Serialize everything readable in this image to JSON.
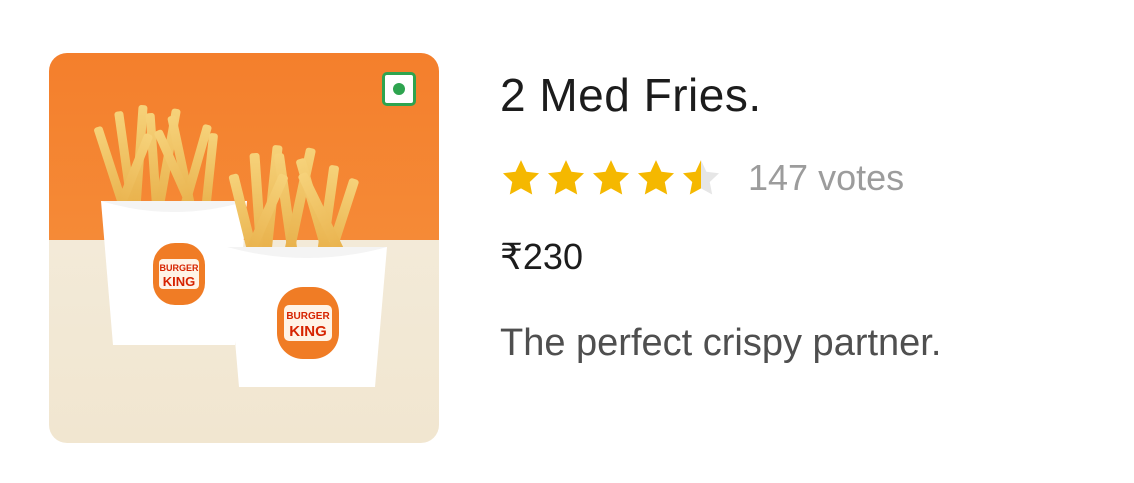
{
  "item": {
    "title": "2 Med Fries.",
    "rating": 4.5,
    "rating_max": 5,
    "votes_label": "147 votes",
    "price": "₹230",
    "description": "The perfect crispy partner.",
    "veg_indicator_color": "#2ea44f",
    "star_color": "#f5b800",
    "star_empty_color": "#e6e6e6",
    "image": {
      "brand_text_line1": "BURGER",
      "brand_text_line2": "KING"
    }
  }
}
